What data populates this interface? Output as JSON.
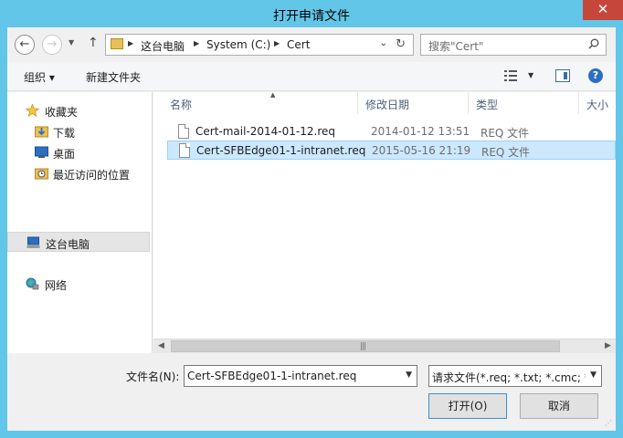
{
  "window": {
    "title": "打开申请文件",
    "close_glyph": "✕"
  },
  "nav": {
    "back": "←",
    "forward": "→",
    "up": "↑",
    "breadcrumb": [
      "这台电脑",
      "System (C:)",
      "Cert"
    ],
    "search_placeholder": "搜索\"Cert\""
  },
  "toolbar": {
    "organize": "组织 ▾",
    "new_folder": "新建文件夹",
    "help": "?"
  },
  "sidebar": {
    "items": [
      {
        "label": "收藏夹",
        "icon": "star-icon"
      },
      {
        "label": "下载",
        "icon": "download-folder-icon"
      },
      {
        "label": "桌面",
        "icon": "desktop-icon"
      },
      {
        "label": "最近访问的位置",
        "icon": "recent-places-icon"
      },
      {
        "label": "这台电脑",
        "icon": "computer-icon",
        "selected": true
      },
      {
        "label": "网络",
        "icon": "network-icon"
      }
    ]
  },
  "file_list": {
    "columns": [
      "名称",
      "修改日期",
      "类型",
      "大小"
    ],
    "rows": [
      {
        "name": "Cert-mail-2014-01-12.req",
        "date": "2014-01-12 13:51",
        "type": "REQ 文件",
        "selected": false
      },
      {
        "name": "Cert-SFBEdge01-1-intranet.req",
        "date": "2015-05-16 21:19",
        "type": "REQ 文件",
        "selected": true
      }
    ]
  },
  "bottom": {
    "filename_label": "文件名(N):",
    "filename_value": "Cert-SFBEdge01-1-intranet.req",
    "filter_value": "请求文件(*.req; *.txt; *.cmc; *.c",
    "open_button": "打开(O)",
    "cancel_button": "取消"
  },
  "colors": {
    "title_bar": "#62c6e8",
    "selection": "#cce8ff",
    "close": "#c7463c"
  }
}
